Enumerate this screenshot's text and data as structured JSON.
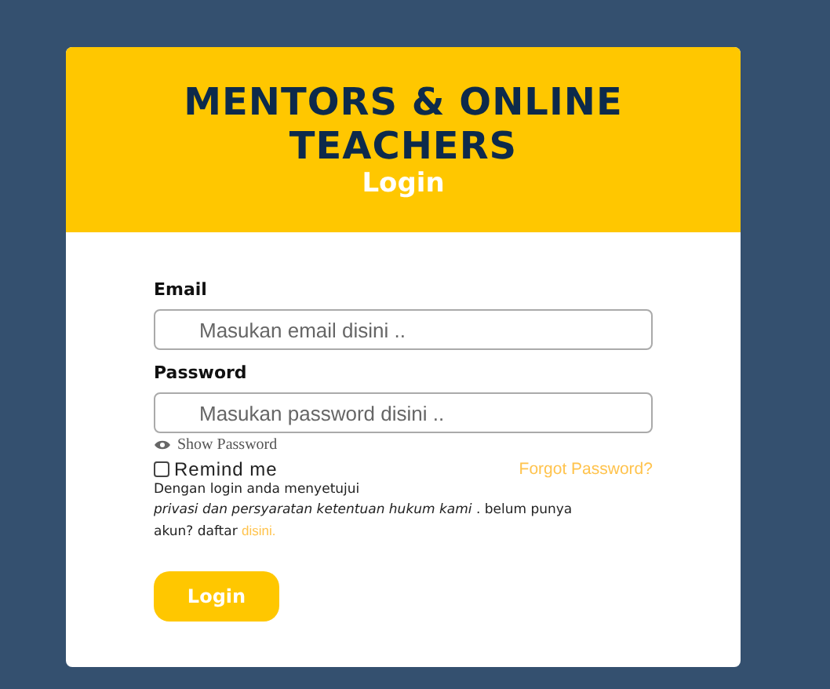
{
  "header": {
    "title": "MENTORS & ONLINE TEACHERS",
    "subtitle": "Login"
  },
  "fields": [
    {
      "label": "Email",
      "placeholder": "Masukan email disini .."
    },
    {
      "label": "Password",
      "placeholder": "Masukan password disini .."
    }
  ],
  "show_password": {
    "label": "Show Password",
    "checked": false
  },
  "remind": {
    "label": "Remind me",
    "checked": false
  },
  "forgot": "Forgot Password?",
  "agreement": {
    "intro": "Dengan login anda menyetujui",
    "text": "*privasi dan persyaratan ketentuan hukum kami* . belum punya akun? daftar",
    "link": "disini."
  },
  "button": "Login"
}
